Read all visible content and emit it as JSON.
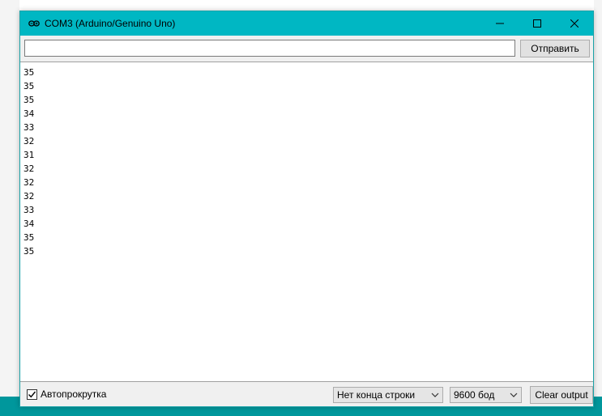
{
  "window": {
    "title": "COM3 (Arduino/Genuino Uno)",
    "app_icon": "arduino-icon",
    "controls": [
      "minimize-icon",
      "maximize-icon",
      "close-icon"
    ],
    "accent_color": "#00b7c3"
  },
  "send": {
    "input_value": "",
    "button_label": "Отправить"
  },
  "output": {
    "lines": [
      "35",
      "35",
      "35",
      "34",
      "33",
      "32",
      "31",
      "32",
      "32",
      "32",
      "33",
      "34",
      "35",
      "35"
    ]
  },
  "footer": {
    "autoscroll_label": "Автопрокрутка",
    "autoscroll_checked": true,
    "line_ending": "Нет конца строки",
    "baud_rate": "9600 бод",
    "clear_label": "Clear output"
  }
}
